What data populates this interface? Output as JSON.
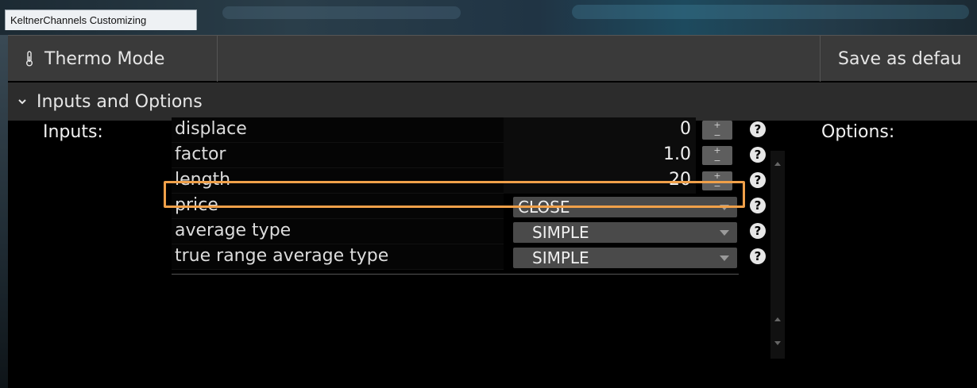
{
  "window": {
    "title": "KeltnerChannels Customizing"
  },
  "toolbar": {
    "thermo_mode_label": "Thermo Mode",
    "save_as_default_label": "Save as defau"
  },
  "section": {
    "title": "Inputs and Options"
  },
  "labels": {
    "inputs": "Inputs:",
    "options": "Options:"
  },
  "inputs": [
    {
      "name": "displace",
      "value": "0",
      "control": "stepper"
    },
    {
      "name": "factor",
      "value": "1.0",
      "control": "stepper"
    },
    {
      "name": "length",
      "value": "20",
      "control": "stepper"
    },
    {
      "name": "price",
      "value": "CLOSE",
      "control": "dropdown"
    },
    {
      "name": "average type",
      "value": "SIMPLE",
      "control": "dropdown"
    },
    {
      "name": "true range average type",
      "value": "SIMPLE",
      "control": "dropdown"
    }
  ],
  "help_glyph": "?",
  "stepper_glyphs": {
    "up": "+",
    "down": "−"
  },
  "colors": {
    "highlight": "#f0a049",
    "toolbar_bg": "#3a3a3a",
    "section_bg": "#2c2c2c"
  },
  "highlighted_input": "factor"
}
